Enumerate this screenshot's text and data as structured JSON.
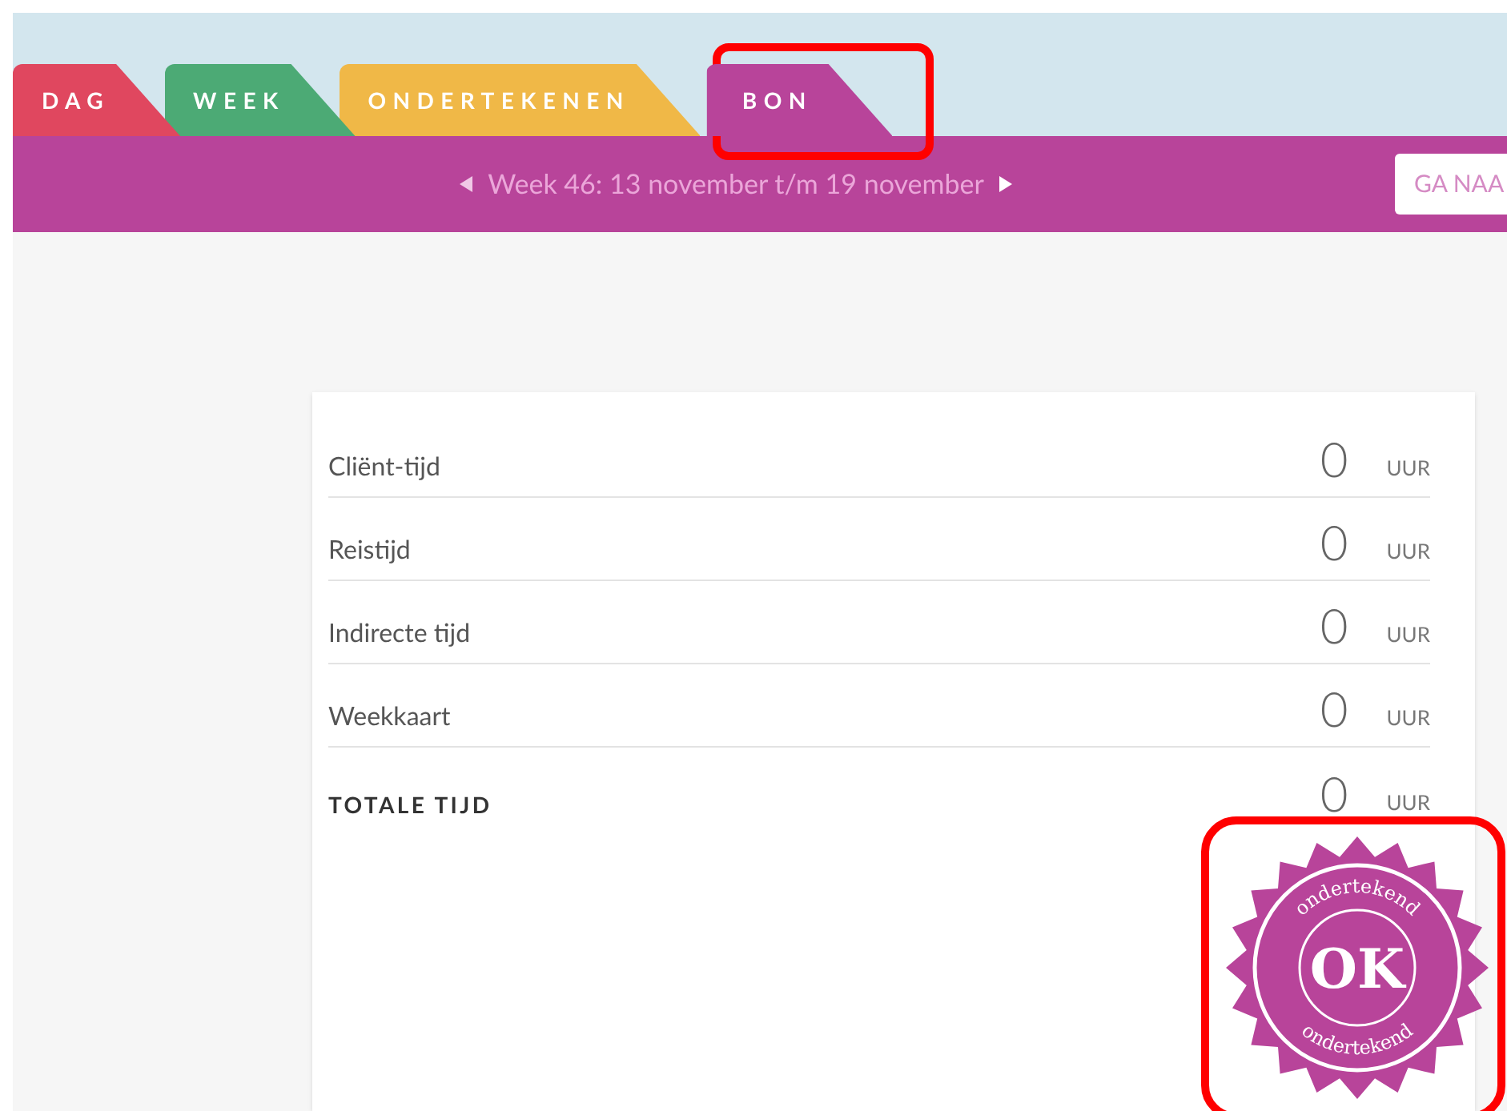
{
  "tabs": [
    {
      "label": "DAG",
      "color": "#e0475f",
      "selected": false
    },
    {
      "label": "WEEK",
      "color": "#4caa75",
      "selected": false
    },
    {
      "label": "ONDERTEKENEN",
      "color": "#f0b847",
      "selected": false
    },
    {
      "label": "BON",
      "color": "#b8449a",
      "selected": true
    }
  ],
  "week_nav": {
    "label": "Week 46: 13 november t/m 19 november",
    "goto_button": "GA NAA"
  },
  "summary": {
    "rows": [
      {
        "label": "Cliënt-tijd",
        "value": "0",
        "unit": "UUR",
        "kind": "item"
      },
      {
        "label": "Reistijd",
        "value": "0",
        "unit": "UUR",
        "kind": "item"
      },
      {
        "label": "Indirecte tijd",
        "value": "0",
        "unit": "UUR",
        "kind": "item"
      },
      {
        "label": "Weekkaart",
        "value": "0",
        "unit": "UUR",
        "kind": "item"
      },
      {
        "label": "TOTALE TIJD",
        "value": "0",
        "unit": "UUR",
        "kind": "total"
      }
    ]
  },
  "stamp": {
    "top_text": "ondertekend",
    "center_text": "OK",
    "bottom_text": "ondertekend"
  }
}
